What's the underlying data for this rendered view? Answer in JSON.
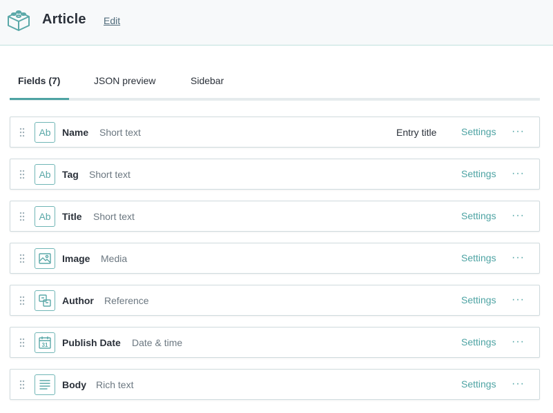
{
  "header": {
    "title": "Article",
    "edit_label": "Edit",
    "logo_icon": "content-type-box-icon"
  },
  "tabs": [
    {
      "label": "Fields (7)",
      "active": true
    },
    {
      "label": "JSON preview",
      "active": false
    },
    {
      "label": "Sidebar",
      "active": false
    }
  ],
  "fields": [
    {
      "name": "Name",
      "type": "Short text",
      "icon": "text-ab-icon",
      "entry_title": "Entry title",
      "settings_label": "Settings"
    },
    {
      "name": "Tag",
      "type": "Short text",
      "icon": "text-ab-icon",
      "settings_label": "Settings"
    },
    {
      "name": "Title",
      "type": "Short text",
      "icon": "text-ab-icon",
      "settings_label": "Settings"
    },
    {
      "name": "Image",
      "type": "Media",
      "icon": "media-image-icon",
      "settings_label": "Settings"
    },
    {
      "name": "Author",
      "type": "Reference",
      "icon": "reference-icon",
      "settings_label": "Settings"
    },
    {
      "name": "Publish Date",
      "type": "Date & time",
      "icon": "calendar-icon",
      "icon_text": "31",
      "settings_label": "Settings"
    },
    {
      "name": "Body",
      "type": "Rich text",
      "icon": "rich-text-icon",
      "settings_label": "Settings"
    }
  ],
  "colors": {
    "accent": "#4da3a3",
    "header_bg": "#f7f9fa",
    "text": "#2a3039",
    "muted": "#6b7780"
  }
}
